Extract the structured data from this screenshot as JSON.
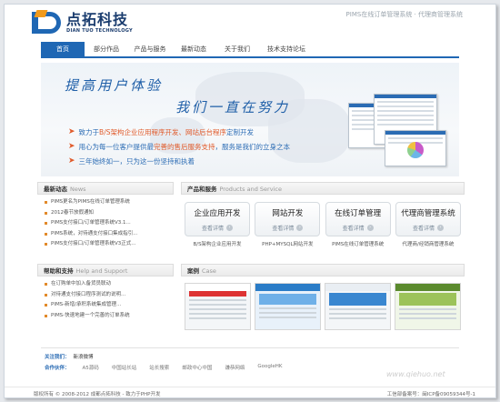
{
  "header": {
    "logo_cn": "点拓科技",
    "logo_en": "DIAN TUO TECHNOLOGY",
    "tagline": "PIMS在线订单管理系统 · 代理商管理系统"
  },
  "nav": [
    "首页",
    "部分作品",
    "产品与服务",
    "最新动态",
    "关于我们",
    "技术支持论坛"
  ],
  "banner": {
    "slogan_1": "提高用户体验",
    "slogan_2": "我们一直在努力",
    "b1_pre": "致力于",
    "b1_hl": "B/S架构企业应用程序开发、网站后台程序",
    "b1_post": "定制开发",
    "b2_pre": "用心为每一位客户提供最",
    "b2_hl": "完善的售后服务支持",
    "b2_post": "，服务是我们的立身之本",
    "b3": "三年始终如一，只为这一份坚持和执着"
  },
  "news": {
    "title": "最新动态",
    "title_en": "News",
    "items": [
      "PIMS更名为PIMS在线订单管理系统",
      "2012春节放假通知",
      "PIMS支付接口/订单管理系统V3.1...",
      "PIMS系统，对待通支付接口集成指引...",
      "PIMS支付接口/订单管理系统V3正式..."
    ]
  },
  "help": {
    "title": "帮助和支持",
    "title_en": "Help and Support",
    "items": [
      "在订购单中加入备货员联动",
      "对待通支付接口程序测试的说明...",
      "PIMS-新增/承积系统集成管理...",
      "PIMS-快速地建一个完善的订单系统"
    ]
  },
  "products": {
    "title": "产品和服务",
    "title_en": "Products and Service",
    "more_label": "查看详情",
    "items": [
      {
        "name": "企业应用开发",
        "caption": "B/S架构企业应用开发"
      },
      {
        "name": "网站开发",
        "caption": "PHP+MYSQL网站开发"
      },
      {
        "name": "在线订单管理",
        "caption": "PIMS在线订单管理系统"
      },
      {
        "name": "代理商管理系统",
        "caption": "代理商/经销商管理系统"
      }
    ]
  },
  "cases": {
    "title": "案例",
    "title_en": "Case",
    "count": 4
  },
  "links": {
    "follow_label": "关注我们：",
    "follow_value": "新浪微博",
    "partners_label": "合作伙伴：",
    "partners": [
      "A5源码",
      "中国站长站",
      "站长搜索",
      "邮政中心中国",
      "谦恭网络",
      "GoogleHK"
    ]
  },
  "footer": {
    "copyright": "版权所有 © 2008-2012 成都点拓科技 - 致力于PHP开发",
    "icp": "工信部备案号：闽ICP备09059344号-1"
  },
  "watermark": "www.qiehuo.net",
  "colors": {
    "brand_blue": "#1f67b4",
    "accent_orange": "#e05a2a"
  }
}
